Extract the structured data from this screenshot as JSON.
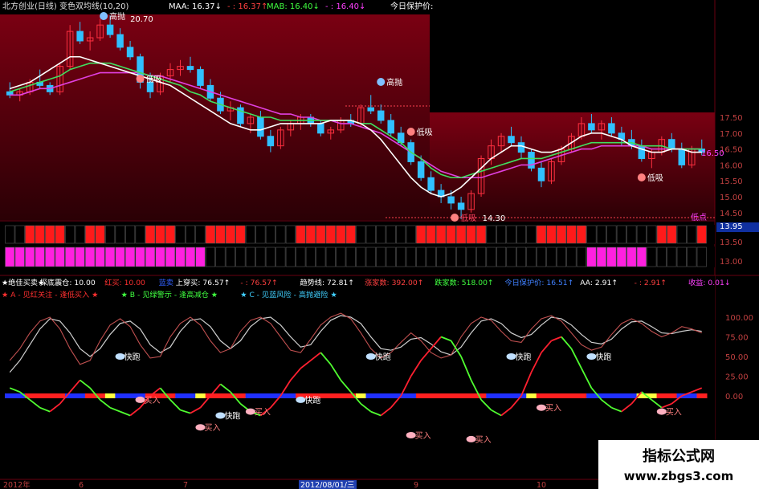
{
  "header": {
    "title": "北方创业(日线) 变色双均线(10,20)",
    "maa_label": "MAA: 16.37↓",
    "maa_val2": "- : 16.37↑",
    "mab_label": "MAB: 16.40↓",
    "mab_val2": "- : 16.40↓",
    "today_label": "今日保护价:"
  },
  "price_axis": [
    "17.50",
    "17.00",
    "16.50",
    "16.00",
    "15.50",
    "15.00",
    "14.50",
    "13.95",
    "13.50",
    "13.00"
  ],
  "price_annotations": {
    "high_label": "20.70",
    "low_label": "14.30",
    "right_tag": "低点",
    "right_value": "16.50",
    "chao": "高抛",
    "di": "低吸"
  },
  "indicator": {
    "line1": [
      {
        "text": "★绝佳买卖★",
        "color": "#ffffff"
      },
      {
        "text": "探底震仓: 10.00",
        "color": "#ffffff"
      },
      {
        "text": "红买: 10.00",
        "color": "#ff3030"
      },
      {
        "text": "蓝卖",
        "color": "#3060ff"
      },
      {
        "text": "上穿买: 76.57↑",
        "color": "#ffffff"
      },
      {
        "text": "- : 76.57↑",
        "color": "#ff4040"
      },
      {
        "text": "趋势线: 72.81↑",
        "color": "#ffffff"
      },
      {
        "text": "涨家数: 392.00↑",
        "color": "#ff4040"
      },
      {
        "text": "跌家数: 518.00↑",
        "color": "#40ff40"
      },
      {
        "text": "今日保护价: 16.51↑",
        "color": "#4080ff"
      },
      {
        "text": "AA: 2.91↑",
        "color": "#ffffff"
      },
      {
        "text": "- : 2.91↑",
        "color": "#ff4040"
      },
      {
        "text": "收益: 0.01↓",
        "color": "#ff40ff"
      }
    ],
    "line2": [
      {
        "text": "★ A - 见红关注 - 逢低买入 ★",
        "color": "#ff3030"
      },
      {
        "text": "★ B - 见绿警示 - 逢高减仓 ★",
        "color": "#40ff40"
      },
      {
        "text": "★ C - 见蓝风险 - 高抛避险 ★",
        "color": "#40d0ff"
      }
    ],
    "axis": [
      "100.00",
      "75.00",
      "50.00",
      "25.00",
      "0.00"
    ],
    "buy_label": "买入",
    "sell_label": "快跑"
  },
  "time_axis": [
    "2012年",
    "6",
    "7",
    "2012/08/01/三",
    "9",
    "10"
  ],
  "watermark": {
    "title": "指标公式网",
    "url": "www.zbgs3.com"
  },
  "colors": {
    "up": "#ff3040",
    "down": "#30c0ff",
    "ma_white": "#ffffff",
    "ma_green": "#40e060",
    "ma_magenta": "#e040e0",
    "bg_top": "#000000",
    "bg_red": "#5a0008"
  },
  "chart_data": {
    "type": "candlestick",
    "price_ylim": [
      12.8,
      21.0
    ],
    "candles": [
      [
        18.3,
        18.6,
        18.1,
        18.2
      ],
      [
        18.2,
        18.4,
        18.0,
        18.3
      ],
      [
        18.3,
        18.7,
        18.2,
        18.6
      ],
      [
        18.6,
        19.0,
        18.4,
        18.5
      ],
      [
        18.5,
        18.6,
        18.2,
        18.3
      ],
      [
        18.3,
        19.2,
        18.2,
        19.1
      ],
      [
        19.1,
        20.4,
        19.0,
        20.2
      ],
      [
        20.2,
        20.5,
        19.8,
        19.9
      ],
      [
        19.9,
        20.2,
        19.6,
        20.0
      ],
      [
        20.0,
        20.6,
        19.9,
        20.4
      ],
      [
        20.4,
        20.7,
        20.0,
        20.1
      ],
      [
        20.1,
        20.3,
        19.6,
        19.7
      ],
      [
        19.7,
        19.9,
        19.3,
        19.4
      ],
      [
        19.4,
        19.5,
        18.4,
        18.6
      ],
      [
        18.6,
        18.9,
        18.1,
        18.3
      ],
      [
        18.3,
        18.9,
        18.2,
        18.8
      ],
      [
        18.8,
        19.2,
        18.6,
        19.0
      ],
      [
        19.0,
        19.3,
        18.8,
        19.1
      ],
      [
        19.1,
        19.4,
        18.9,
        19.0
      ],
      [
        19.0,
        19.1,
        18.4,
        18.5
      ],
      [
        18.5,
        18.7,
        18.0,
        18.1
      ],
      [
        18.1,
        18.3,
        17.6,
        17.7
      ],
      [
        17.7,
        18.0,
        17.4,
        17.8
      ],
      [
        17.8,
        17.9,
        17.2,
        17.3
      ],
      [
        17.3,
        17.6,
        17.0,
        17.5
      ],
      [
        17.5,
        17.7,
        16.8,
        16.9
      ],
      [
        16.9,
        17.1,
        16.4,
        16.6
      ],
      [
        16.6,
        17.2,
        16.5,
        17.1
      ],
      [
        17.1,
        17.4,
        16.9,
        17.3
      ],
      [
        17.3,
        17.6,
        17.1,
        17.5
      ],
      [
        17.5,
        17.6,
        17.2,
        17.3
      ],
      [
        17.3,
        17.4,
        16.9,
        17.0
      ],
      [
        17.0,
        17.2,
        16.8,
        17.1
      ],
      [
        17.1,
        17.5,
        17.0,
        17.4
      ],
      [
        17.4,
        17.6,
        17.2,
        17.3
      ],
      [
        17.3,
        17.9,
        17.2,
        17.8
      ],
      [
        17.8,
        18.2,
        17.6,
        17.7
      ],
      [
        17.7,
        17.9,
        17.3,
        17.4
      ],
      [
        17.4,
        17.6,
        16.9,
        17.0
      ],
      [
        17.0,
        17.2,
        16.6,
        16.7
      ],
      [
        16.7,
        16.8,
        16.0,
        16.1
      ],
      [
        16.1,
        16.3,
        15.5,
        15.6
      ],
      [
        15.6,
        15.8,
        15.1,
        15.2
      ],
      [
        15.2,
        15.4,
        14.8,
        15.0
      ],
      [
        15.0,
        15.2,
        14.6,
        14.8
      ],
      [
        14.8,
        15.0,
        14.3,
        14.6
      ],
      [
        14.6,
        15.2,
        14.5,
        15.1
      ],
      [
        15.1,
        16.3,
        15.0,
        16.2
      ],
      [
        16.2,
        16.8,
        16.0,
        16.6
      ],
      [
        16.6,
        17.0,
        16.4,
        16.9
      ],
      [
        16.9,
        17.2,
        16.6,
        16.7
      ],
      [
        16.7,
        16.9,
        16.2,
        16.4
      ],
      [
        16.4,
        16.5,
        15.8,
        15.9
      ],
      [
        15.9,
        16.1,
        15.3,
        15.5
      ],
      [
        15.5,
        16.2,
        15.4,
        16.1
      ],
      [
        16.1,
        16.6,
        16.0,
        16.5
      ],
      [
        16.5,
        17.0,
        16.4,
        16.9
      ],
      [
        16.9,
        17.5,
        16.8,
        17.3
      ],
      [
        17.3,
        17.6,
        17.0,
        17.1
      ],
      [
        17.1,
        17.4,
        16.8,
        17.3
      ],
      [
        17.3,
        17.5,
        16.9,
        17.0
      ],
      [
        17.0,
        17.2,
        16.6,
        16.8
      ],
      [
        16.8,
        17.1,
        16.5,
        16.6
      ],
      [
        16.6,
        16.8,
        16.1,
        16.2
      ],
      [
        16.2,
        16.5,
        15.9,
        16.4
      ],
      [
        16.4,
        16.9,
        16.3,
        16.8
      ],
      [
        16.8,
        17.0,
        16.4,
        16.5
      ],
      [
        16.5,
        16.7,
        15.9,
        16.0
      ],
      [
        16.0,
        16.6,
        15.9,
        16.5
      ],
      [
        16.5,
        16.8,
        16.3,
        16.4
      ]
    ],
    "ma_white": [
      18.4,
      18.5,
      18.6,
      18.8,
      19.0,
      19.2,
      19.4,
      19.4,
      19.3,
      19.2,
      19.1,
      19.0,
      18.9,
      18.8,
      18.7,
      18.6,
      18.5,
      18.3,
      18.1,
      17.9,
      17.7,
      17.5,
      17.3,
      17.2,
      17.1,
      17.1,
      17.2,
      17.3,
      17.3,
      17.3,
      17.3,
      17.3,
      17.4,
      17.4,
      17.4,
      17.3,
      17.1,
      16.8,
      16.4,
      16.0,
      15.6,
      15.3,
      15.1,
      15.0,
      15.1,
      15.3,
      15.6,
      15.9,
      16.2,
      16.4,
      16.6,
      16.6,
      16.5,
      16.4,
      16.4,
      16.5,
      16.7,
      16.9,
      17.0,
      17.0,
      16.9,
      16.8,
      16.6,
      16.5,
      16.4,
      16.4,
      16.5,
      16.5,
      16.4,
      16.4
    ],
    "ma_green": [
      18.3,
      18.4,
      18.5,
      18.6,
      18.7,
      18.8,
      19.0,
      19.1,
      19.2,
      19.2,
      19.2,
      19.1,
      19.0,
      18.9,
      18.8,
      18.7,
      18.6,
      18.5,
      18.3,
      18.2,
      18.0,
      17.9,
      17.8,
      17.7,
      17.6,
      17.5,
      17.5,
      17.4,
      17.4,
      17.4,
      17.4,
      17.4,
      17.4,
      17.4,
      17.4,
      17.3,
      17.3,
      17.1,
      16.9,
      16.7,
      16.4,
      16.2,
      15.9,
      15.7,
      15.6,
      15.6,
      15.7,
      15.8,
      15.9,
      16.0,
      16.1,
      16.2,
      16.2,
      16.2,
      16.3,
      16.4,
      16.5,
      16.6,
      16.7,
      16.7,
      16.7,
      16.7,
      16.7,
      16.6,
      16.6,
      16.6,
      16.5,
      16.5,
      16.5,
      16.5
    ],
    "ma_magenta": [
      18.2,
      18.2,
      18.3,
      18.4,
      18.4,
      18.5,
      18.6,
      18.7,
      18.8,
      18.9,
      18.9,
      18.9,
      18.9,
      18.9,
      18.8,
      18.8,
      18.7,
      18.6,
      18.5,
      18.4,
      18.3,
      18.2,
      18.1,
      18.0,
      17.9,
      17.8,
      17.7,
      17.6,
      17.6,
      17.5,
      17.5,
      17.4,
      17.4,
      17.3,
      17.3,
      17.2,
      17.1,
      17.0,
      16.8,
      16.6,
      16.4,
      16.2,
      16.0,
      15.8,
      15.7,
      15.6,
      15.6,
      15.6,
      15.7,
      15.8,
      15.9,
      16.0,
      16.0,
      16.1,
      16.2,
      16.3,
      16.4,
      16.5,
      16.5,
      16.6,
      16.6,
      16.6,
      16.6,
      16.6,
      16.5,
      16.5,
      16.5,
      16.5,
      16.5,
      16.5
    ],
    "osc_ylim": [
      -30,
      115
    ],
    "osc_fast": [
      45,
      60,
      80,
      95,
      100,
      85,
      60,
      40,
      45,
      70,
      90,
      98,
      88,
      65,
      48,
      50,
      75,
      92,
      100,
      90,
      70,
      55,
      60,
      82,
      96,
      100,
      92,
      75,
      58,
      55,
      72,
      90,
      100,
      105,
      98,
      80,
      60,
      48,
      55,
      68,
      80,
      70,
      55,
      48,
      52,
      75,
      92,
      100,
      96,
      82,
      70,
      68,
      85,
      98,
      102,
      95,
      80,
      65,
      58,
      62,
      78,
      92,
      98,
      92,
      82,
      75,
      80,
      88,
      85,
      80
    ],
    "osc_slow": [
      30,
      45,
      65,
      85,
      98,
      95,
      80,
      60,
      50,
      60,
      78,
      92,
      95,
      85,
      65,
      55,
      62,
      82,
      96,
      98,
      88,
      70,
      60,
      70,
      88,
      98,
      100,
      90,
      75,
      62,
      65,
      82,
      96,
      102,
      100,
      92,
      75,
      60,
      58,
      62,
      72,
      74,
      66,
      56,
      52,
      62,
      80,
      95,
      98,
      92,
      80,
      74,
      78,
      90,
      100,
      98,
      90,
      78,
      68,
      66,
      72,
      85,
      94,
      95,
      88,
      80,
      79,
      82,
      84,
      82
    ],
    "osc_signal": [
      10,
      5,
      -5,
      -15,
      -20,
      -10,
      5,
      20,
      10,
      -5,
      -15,
      -20,
      -25,
      -15,
      0,
      10,
      -5,
      -18,
      -22,
      -15,
      0,
      15,
      5,
      -10,
      -20,
      -25,
      -15,
      0,
      20,
      35,
      45,
      55,
      40,
      20,
      5,
      -10,
      -20,
      -25,
      -15,
      0,
      25,
      45,
      60,
      75,
      70,
      50,
      20,
      -5,
      -18,
      -25,
      -15,
      0,
      30,
      55,
      70,
      75,
      60,
      35,
      10,
      -5,
      -15,
      -20,
      -10,
      5,
      -5,
      -15,
      -10,
      0,
      5,
      10
    ],
    "signal_strip": [
      "blue",
      "blue",
      "red",
      "red",
      "red",
      "red",
      "blue",
      "blue",
      "red",
      "red",
      "yellow",
      "blue",
      "blue",
      "blue",
      "red",
      "red",
      "red",
      "blue",
      "blue",
      "yellow",
      "red",
      "red",
      "red",
      "red",
      "blue",
      "blue",
      "blue",
      "blue",
      "blue",
      "red",
      "red",
      "red",
      "red",
      "red",
      "red",
      "yellow",
      "blue",
      "blue",
      "blue",
      "blue",
      "blue",
      "red",
      "red",
      "red",
      "red",
      "red",
      "red",
      "red",
      "blue",
      "blue",
      "blue",
      "blue",
      "yellow",
      "red",
      "red",
      "red",
      "red",
      "red",
      "blue",
      "blue",
      "blue",
      "blue",
      "blue",
      "yellow",
      "yellow",
      "red",
      "red",
      "blue",
      "blue",
      "red"
    ]
  }
}
